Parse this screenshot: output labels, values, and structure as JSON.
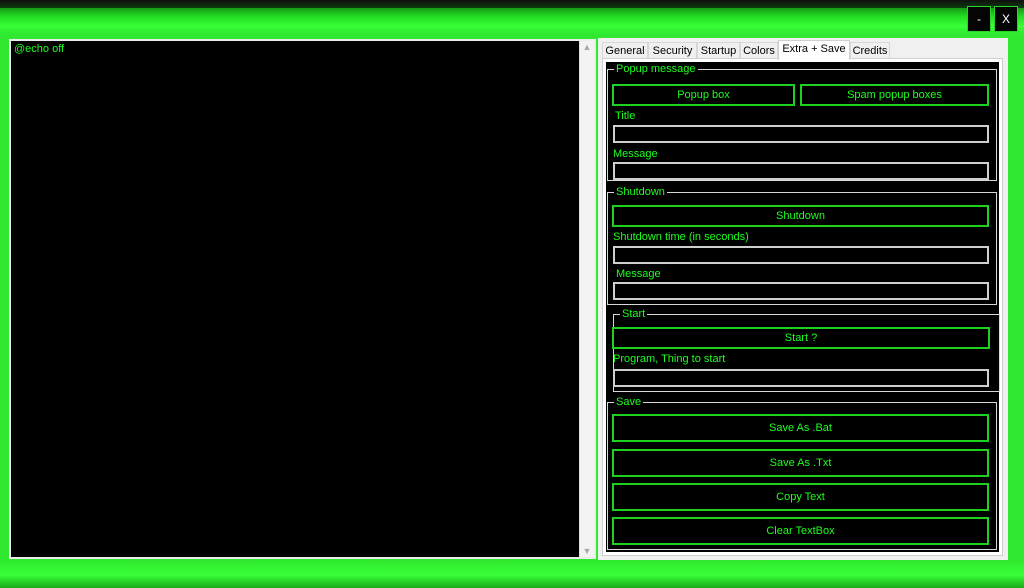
{
  "window": {
    "minimize_label": "-",
    "close_label": "X"
  },
  "editor": {
    "content": "@echo off"
  },
  "tabs": [
    {
      "label": "General"
    },
    {
      "label": "Security"
    },
    {
      "label": "Startup"
    },
    {
      "label": "Colors"
    },
    {
      "label": "Extra + Save"
    },
    {
      "label": "Credits"
    }
  ],
  "active_tab": "Extra + Save",
  "popup": {
    "group_label": "Popup message",
    "popup_button": "Popup box",
    "spam_button": "Spam popup boxes",
    "title_label": "Title",
    "title_value": "",
    "message_label": "Message",
    "message_value": ""
  },
  "shutdown": {
    "group_label": "Shutdown",
    "button": "Shutdown",
    "time_label": "Shutdown time (in seconds)",
    "time_value": "",
    "message_label": "Message",
    "message_value": ""
  },
  "start": {
    "group_label": "Start",
    "button": "Start ?",
    "program_label": "Program, Thing to start",
    "program_value": ""
  },
  "save": {
    "group_label": "Save",
    "save_bat": "Save As .Bat",
    "save_txt": "Save As .Txt",
    "copy": "Copy Text",
    "clear": "Clear TextBox"
  },
  "colors": {
    "accent": "#1eff1e",
    "frame": "#2fe82f",
    "background": "#000000"
  }
}
